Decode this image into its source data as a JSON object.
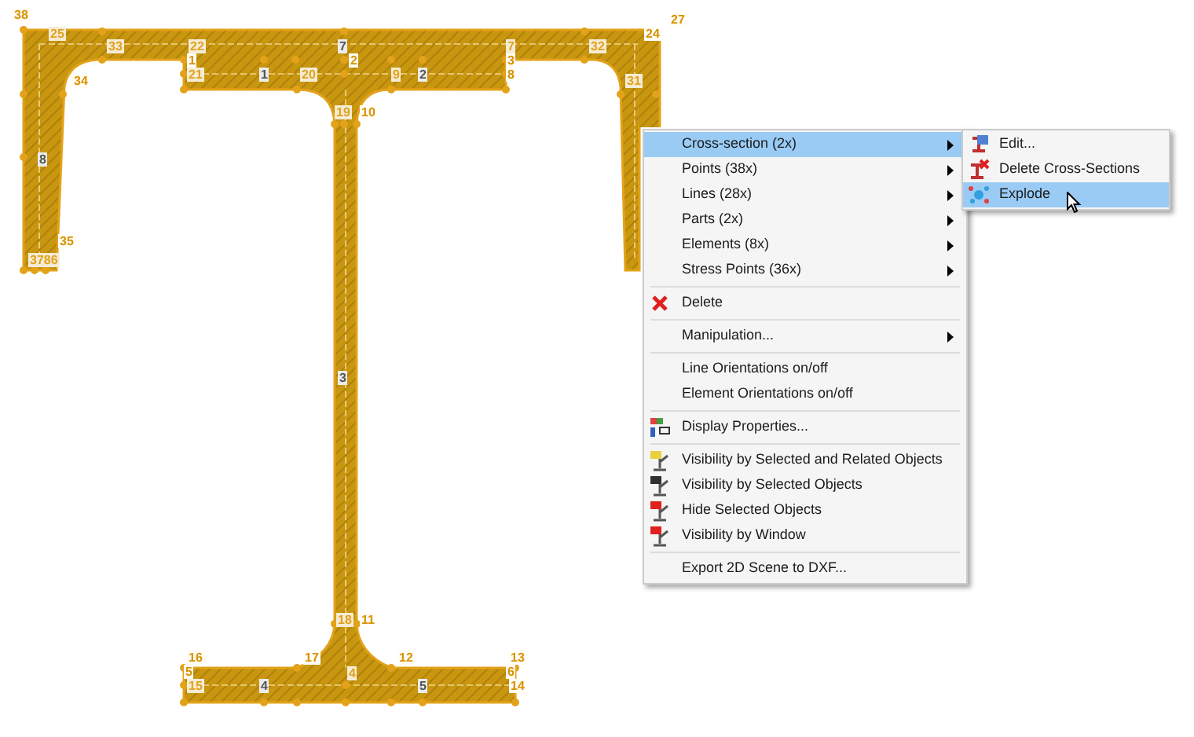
{
  "drawing": {
    "labels": [
      {
        "text": "38",
        "kind": "point"
      },
      {
        "text": "25",
        "kind": "node"
      },
      {
        "text": "33",
        "kind": "node"
      },
      {
        "text": "22",
        "kind": "node"
      },
      {
        "text": "7",
        "kind": "line"
      },
      {
        "text": "7",
        "kind": "node"
      },
      {
        "text": "32",
        "kind": "node"
      },
      {
        "text": "24",
        "kind": "point"
      },
      {
        "text": "27",
        "kind": "point"
      },
      {
        "text": "1",
        "kind": "point"
      },
      {
        "text": "2",
        "kind": "point"
      },
      {
        "text": "3",
        "kind": "point"
      },
      {
        "text": "21",
        "kind": "node"
      },
      {
        "text": "1",
        "kind": "line"
      },
      {
        "text": "20",
        "kind": "node"
      },
      {
        "text": "9",
        "kind": "node"
      },
      {
        "text": "2",
        "kind": "line"
      },
      {
        "text": "8",
        "kind": "point"
      },
      {
        "text": "34",
        "kind": "point"
      },
      {
        "text": "31",
        "kind": "node"
      },
      {
        "text": "19",
        "kind": "node"
      },
      {
        "text": "10",
        "kind": "point"
      },
      {
        "text": "8",
        "kind": "line"
      },
      {
        "text": "35",
        "kind": "point"
      },
      {
        "text": "3786",
        "kind": "node"
      },
      {
        "text": "3",
        "kind": "line"
      },
      {
        "text": "18",
        "kind": "node"
      },
      {
        "text": "11",
        "kind": "point"
      },
      {
        "text": "16",
        "kind": "point"
      },
      {
        "text": "17",
        "kind": "point"
      },
      {
        "text": "12",
        "kind": "point"
      },
      {
        "text": "13",
        "kind": "point"
      },
      {
        "text": "5",
        "kind": "point"
      },
      {
        "text": "6",
        "kind": "point"
      },
      {
        "text": "15",
        "kind": "node"
      },
      {
        "text": "4",
        "kind": "line"
      },
      {
        "text": "4",
        "kind": "node"
      },
      {
        "text": "5",
        "kind": "line"
      },
      {
        "text": "14",
        "kind": "point"
      }
    ]
  },
  "context_menu": {
    "items": [
      {
        "kind": "item",
        "label": "Cross-section (2x)",
        "has_submenu": true,
        "selected": true
      },
      {
        "kind": "item",
        "label": "Points (38x)",
        "has_submenu": true,
        "selected": false
      },
      {
        "kind": "item",
        "label": "Lines (28x)",
        "has_submenu": true,
        "selected": false
      },
      {
        "kind": "item",
        "label": "Parts (2x)",
        "has_submenu": true,
        "selected": false
      },
      {
        "kind": "item",
        "label": "Elements (8x)",
        "has_submenu": true,
        "selected": false
      },
      {
        "kind": "item",
        "label": "Stress Points (36x)",
        "has_submenu": true,
        "selected": false
      },
      {
        "kind": "separator"
      },
      {
        "kind": "item",
        "label": "Delete",
        "has_submenu": false,
        "selected": false
      },
      {
        "kind": "separator"
      },
      {
        "kind": "item",
        "label": "Manipulation...",
        "has_submenu": true,
        "selected": false
      },
      {
        "kind": "separator"
      },
      {
        "kind": "item",
        "label": "Line Orientations on/off",
        "has_submenu": false,
        "selected": false
      },
      {
        "kind": "item",
        "label": "Element Orientations on/off",
        "has_submenu": false,
        "selected": false
      },
      {
        "kind": "separator"
      },
      {
        "kind": "item",
        "label": "Display Properties...",
        "has_submenu": false,
        "selected": false
      },
      {
        "kind": "separator"
      },
      {
        "kind": "item",
        "label": "Visibility by Selected and Related Objects",
        "has_submenu": false,
        "selected": false
      },
      {
        "kind": "item",
        "label": "Visibility by Selected Objects",
        "has_submenu": false,
        "selected": false
      },
      {
        "kind": "item",
        "label": "Hide Selected Objects",
        "has_submenu": false,
        "selected": false
      },
      {
        "kind": "item",
        "label": "Visibility by Window",
        "has_submenu": false,
        "selected": false
      },
      {
        "kind": "separator"
      },
      {
        "kind": "item",
        "label": "Export 2D Scene to DXF...",
        "has_submenu": false,
        "selected": false
      }
    ]
  },
  "submenu": {
    "items": [
      {
        "label": "Edit...",
        "selected": false
      },
      {
        "label": "Delete Cross-Sections",
        "selected": false
      },
      {
        "label": "Explode",
        "selected": true
      }
    ]
  }
}
